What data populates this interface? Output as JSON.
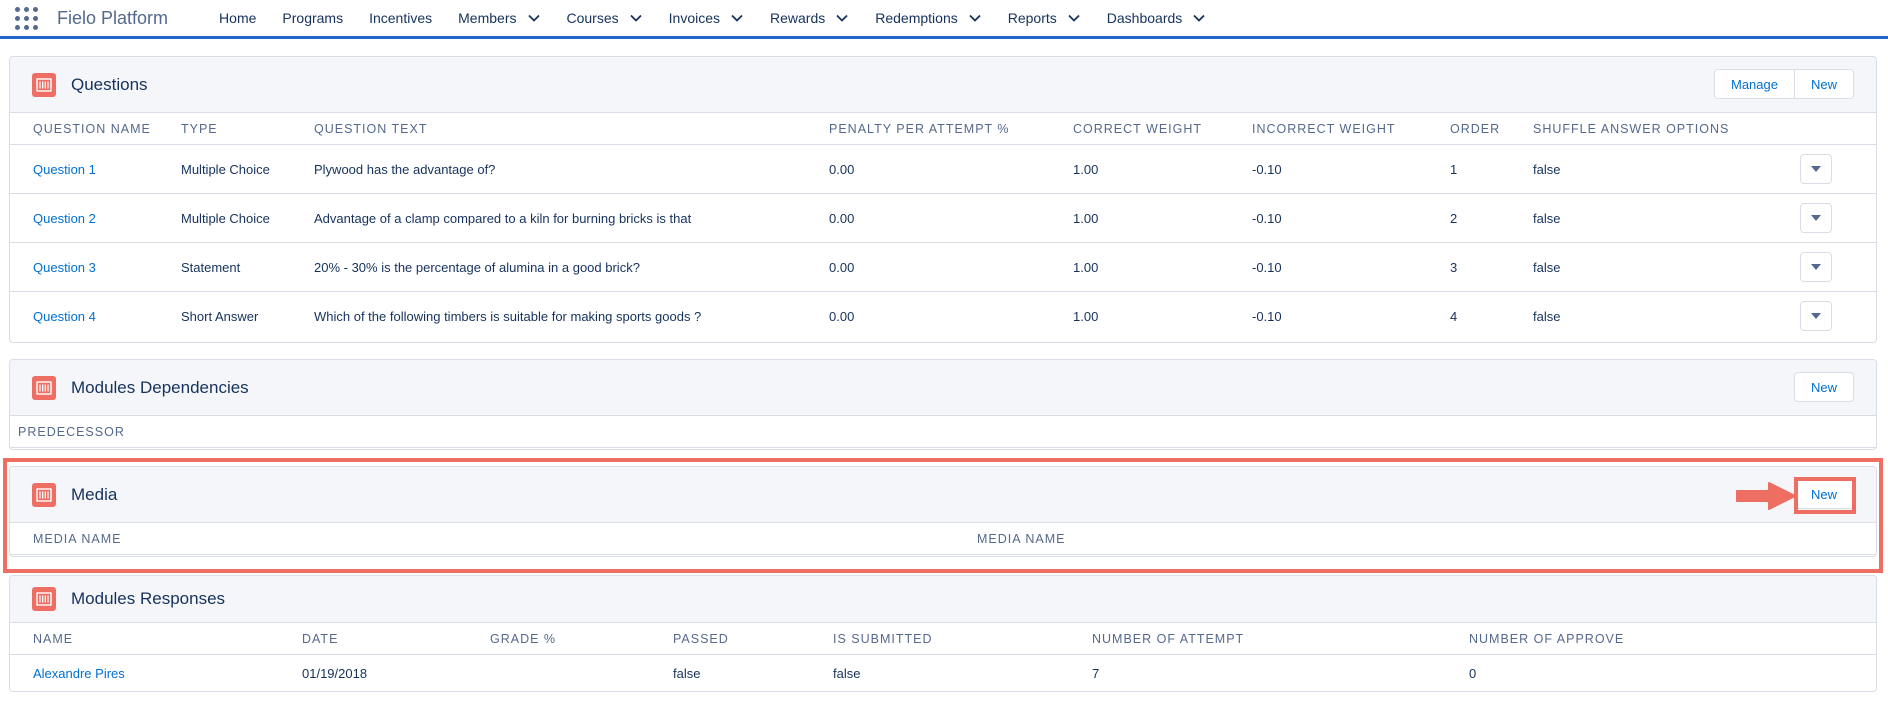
{
  "topnav": {
    "app_name": "Fielo Platform",
    "items": [
      {
        "label": "Home",
        "dropdown": false
      },
      {
        "label": "Programs",
        "dropdown": false
      },
      {
        "label": "Incentives",
        "dropdown": false
      },
      {
        "label": "Members",
        "dropdown": true
      },
      {
        "label": "Courses",
        "dropdown": true
      },
      {
        "label": "Invoices",
        "dropdown": true
      },
      {
        "label": "Rewards",
        "dropdown": true
      },
      {
        "label": "Redemptions",
        "dropdown": true
      },
      {
        "label": "Reports",
        "dropdown": true
      },
      {
        "label": "Dashboards",
        "dropdown": true
      }
    ]
  },
  "questions": {
    "title": "Questions",
    "manage_label": "Manage",
    "new_label": "New",
    "columns": [
      "QUESTION NAME",
      "TYPE",
      "QUESTION TEXT",
      "PENALTY PER ATTEMPT %",
      "CORRECT WEIGHT",
      "INCORRECT WEIGHT",
      "ORDER",
      "SHUFFLE ANSWER OPTIONS"
    ],
    "rows": [
      {
        "name": "Question 1",
        "type": "Multiple Choice",
        "text": "Plywood has the advantage of?",
        "penalty": "0.00",
        "correct": "1.00",
        "incorrect": "-0.10",
        "order": "1",
        "shuffle": "false"
      },
      {
        "name": "Question 2",
        "type": "Multiple Choice",
        "text": "Advantage of a clamp compared to a kiln for burning bricks is that",
        "penalty": "0.00",
        "correct": "1.00",
        "incorrect": "-0.10",
        "order": "2",
        "shuffle": "false"
      },
      {
        "name": "Question 3",
        "type": "Statement",
        "text": "20% - 30% is the percentage of alumina in a good brick?",
        "penalty": "0.00",
        "correct": "1.00",
        "incorrect": "-0.10",
        "order": "3",
        "shuffle": "false"
      },
      {
        "name": "Question 4",
        "type": "Short Answer",
        "text": "Which of the following timbers is suitable for making sports goods ?",
        "penalty": "0.00",
        "correct": "1.00",
        "incorrect": "-0.10",
        "order": "4",
        "shuffle": "false"
      }
    ]
  },
  "dependencies": {
    "title": "Modules Dependencies",
    "new_label": "New",
    "columns": [
      "PREDECESSOR"
    ]
  },
  "media": {
    "title": "Media",
    "new_label": "New",
    "columns": [
      "MEDIA NAME",
      "MEDIA NAME"
    ]
  },
  "responses": {
    "title": "Modules Responses",
    "columns": [
      "NAME",
      "DATE",
      "GRADE %",
      "PASSED",
      "IS SUBMITTED",
      "NUMBER OF ATTEMPT",
      "NUMBER OF APPROVE"
    ],
    "rows": [
      {
        "name": "Alexandre Pires",
        "date": "01/19/2018",
        "grade": "",
        "passed": "false",
        "submitted": "false",
        "attempts": "7",
        "approve": "0"
      }
    ]
  },
  "colors": {
    "accent": "#1f64c9",
    "link": "#0070d2",
    "icon": "#ef6e64",
    "highlight": "#ef6e64"
  },
  "icons": {
    "app_launcher": "waffle-grid-icon",
    "card": "card-list-icon",
    "dropdown": "chevron-down-icon",
    "row_menu": "caret-down-icon",
    "annotation": "arrow-right-icon"
  }
}
